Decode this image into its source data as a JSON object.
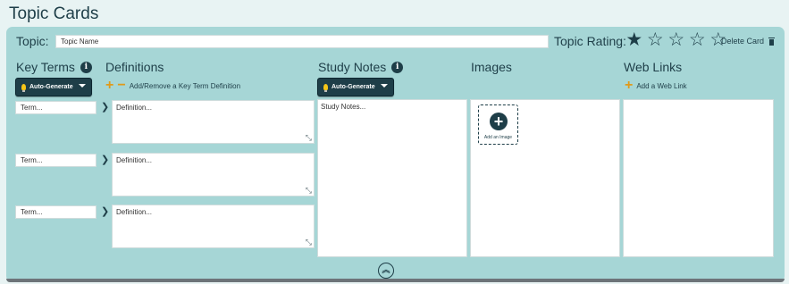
{
  "page_title": "Topic Cards",
  "topic": {
    "label": "Topic:",
    "value": "Topic Name"
  },
  "rating": {
    "label": "Topic Rating:",
    "value": 1,
    "max": 5,
    "filled_star": "★",
    "empty_star": "☆"
  },
  "delete_card": {
    "label": "Delete Card",
    "icon": "trash-icon"
  },
  "columns": {
    "key_terms": "Key Terms",
    "definitions": "Definitions",
    "study_notes": "Study Notes",
    "images": "Images",
    "web_links": "Web Links"
  },
  "info_glyph": "i",
  "auto_generate": "Auto-Generate",
  "add_remove_definition": "Add/Remove a Key Term Definition",
  "plus_glyph": "+",
  "minus_glyph": "−",
  "term_placeholder": "Term...",
  "definition_placeholder": "Definition...",
  "rows": [
    {
      "term": "Term...",
      "definition": "Definition..."
    },
    {
      "term": "Term...",
      "definition": "Definition..."
    },
    {
      "term": "Term...",
      "definition": "Definition..."
    }
  ],
  "arrow_glyph": "❯",
  "resize_glyph": "⤡",
  "study_notes_placeholder": "Study Notes...",
  "add_image": {
    "label": "Add an Image",
    "glyph": "+"
  },
  "add_web_link": "Add a Web Link",
  "collapse_glyph": "︽",
  "colors": {
    "accent_dark": "#1e3e48",
    "card_bg": "#a6d6d6",
    "page_bg": "#e8f3f3",
    "plus_orange": "#e09a1a",
    "bulb_yellow": "#f5c518"
  }
}
